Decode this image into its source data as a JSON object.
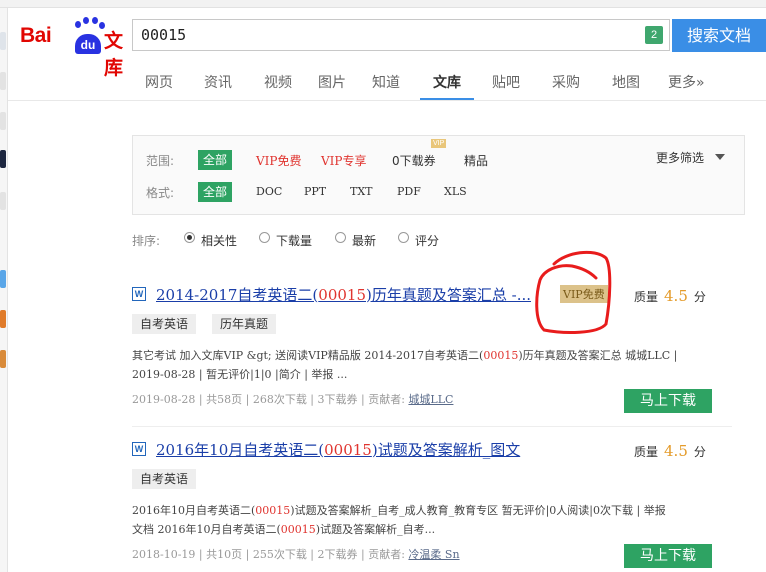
{
  "logo": {
    "bai": "Bai",
    "du": "du",
    "wenku": "文库"
  },
  "search": {
    "query": "00015",
    "badge": "2",
    "button": "搜索文档"
  },
  "nav": [
    "网页",
    "资讯",
    "视频",
    "图片",
    "知道",
    "文库",
    "贴吧",
    "采购",
    "地图",
    "更多»"
  ],
  "filters": {
    "scope_label": "范围:",
    "scope": [
      "全部",
      "VIP免费",
      "VIP专享",
      "0下载券",
      "精品"
    ],
    "vip_tag": "VIP",
    "more": "更多筛选",
    "format_label": "格式:",
    "formats": [
      "全部",
      "DOC",
      "PPT",
      "TXT",
      "PDF",
      "XLS"
    ]
  },
  "sort": {
    "label": "排序:",
    "options": [
      "相关性",
      "下载量",
      "最新",
      "评分"
    ],
    "selected": "相关性"
  },
  "results": [
    {
      "title_pre": "2014-2017自考英语二(",
      "title_hl": "00015",
      "title_post": ")历年真题及答案汇总 -...",
      "vip_free": "VIP免费",
      "quality_label": "质量",
      "score": "4.5",
      "unit": "分",
      "tags": [
        "自考英语",
        "历年真题"
      ],
      "desc1_pre": "其它考试 加入文库VIP &gt; 送阅读VIP精品版 2014-2017自考英语二(",
      "desc1_hl": "00015",
      "desc1_post": ")历年真题及答案汇总 城城LLC |",
      "desc2": "2019-08-28 | 暂无评价|1|0 |简介 | 举报 ...",
      "meta": "2019-08-28  | 共58页 | 268次下载 | 3下载券 | 贡献者: ",
      "author": "城城LLC",
      "download": "马上下载"
    },
    {
      "title_pre": "2016年10月自考英语二(",
      "title_hl": "00015",
      "title_post": ")试题及答案解析_图文",
      "quality_label": "质量",
      "score": "4.5",
      "unit": "分",
      "tags": [
        "自考英语"
      ],
      "desc1_pre": "2016年10月自考英语二(",
      "desc1_hl": "00015",
      "desc1_post": ")试题及答案解析_自考_成人教育_教育专区 暂无评价|0人阅读|0次下载 | 举报",
      "desc2_pre": "文档 2016年10月自考英语二(",
      "desc2_hl": "00015",
      "desc2_post": ")试题及答案解析_自考...",
      "meta": "2018-10-19  | 共10页 | 255次下载 | 2下载券 | 贡献者: ",
      "author": "冷温柔 Sn",
      "download": "马上下载"
    }
  ],
  "colors": {
    "accent": "#3a8ee6",
    "green": "#2ea363",
    "red": "#e0342f",
    "link": "#1a3ea8",
    "score": "#e49b2a"
  }
}
